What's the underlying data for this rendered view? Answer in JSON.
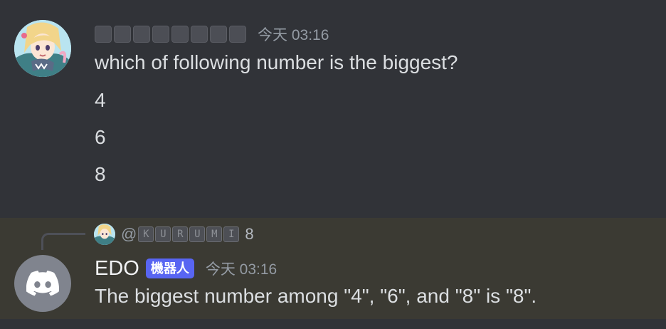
{
  "message1": {
    "author_redacted_blocks": 8,
    "timestamp": "今天 03:16",
    "lines": [
      "which of following number is the biggest?",
      "4",
      "6",
      "8"
    ]
  },
  "message2": {
    "reply": {
      "at": "@",
      "handle_letters": [
        "K",
        "U",
        "R",
        "U",
        "M",
        "I"
      ],
      "snippet": "8"
    },
    "author": "EDO",
    "badge": "機器人",
    "timestamp": "今天 03:16",
    "text": "The biggest number among \"4\", \"6\", and \"8\" is \"8\"."
  },
  "colors": {
    "background": "#313338",
    "highlight": "#3b3a33",
    "bot_badge": "#5865f2",
    "timestamp": "#949ba4",
    "text": "#dbdee1"
  },
  "icons": {
    "user_avatar": "anime-girl-avatar",
    "bot_avatar": "discord-logo-icon"
  }
}
